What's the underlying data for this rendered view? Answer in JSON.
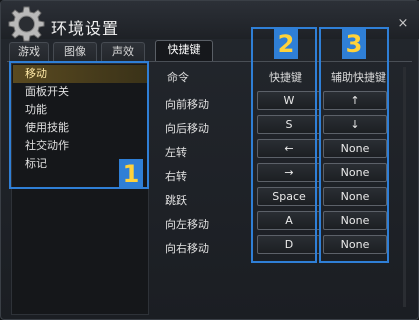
{
  "window": {
    "title": "环境设置",
    "close_label": "×"
  },
  "tabs": [
    {
      "label": "游戏"
    },
    {
      "label": "图像"
    },
    {
      "label": "声效"
    },
    {
      "label": "快捷键",
      "active": true
    }
  ],
  "categories": [
    {
      "label": "移动",
      "selected": true
    },
    {
      "label": "面板开关"
    },
    {
      "label": "功能"
    },
    {
      "label": "使用技能"
    },
    {
      "label": "社交动作"
    },
    {
      "label": "标记"
    }
  ],
  "table": {
    "headers": {
      "command": "命令",
      "hotkey": "快捷键",
      "alt_hotkey": "辅助快捷键"
    },
    "rows": [
      {
        "command": "向前移动",
        "hotkey": "W",
        "alt": "↑"
      },
      {
        "command": "向后移动",
        "hotkey": "S",
        "alt": "↓"
      },
      {
        "command": "左转",
        "hotkey": "←",
        "alt": "None"
      },
      {
        "command": "右转",
        "hotkey": "→",
        "alt": "None"
      },
      {
        "command": "跳跃",
        "hotkey": "Space",
        "alt": "None"
      },
      {
        "command": "向左移动",
        "hotkey": "A",
        "alt": "None"
      },
      {
        "command": "向右移动",
        "hotkey": "D",
        "alt": "None"
      }
    ]
  },
  "annotations": [
    {
      "number": "1"
    },
    {
      "number": "2"
    },
    {
      "number": "3"
    }
  ],
  "colors": {
    "annotation": "#2f7fd6",
    "annotation_text": "#ffd23a",
    "selected": "#5a4a20"
  }
}
